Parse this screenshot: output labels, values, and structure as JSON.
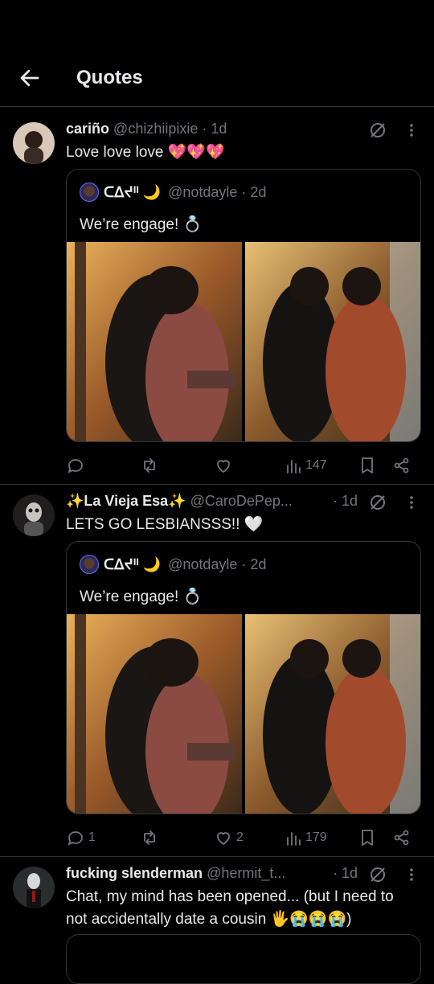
{
  "header": {
    "title": "Quotes"
  },
  "posts": [
    {
      "name": "cariño",
      "handle": "@chizhiipixie · 1d",
      "text": "Love love love 💖💖💖",
      "quote": {
        "name": "ᑕᐃᔪᐦ 🌙",
        "handle": "@notdayle · 2d",
        "text": "We’re engage! 💍"
      },
      "replies": "",
      "reposts": "",
      "likes": "",
      "views": "147"
    },
    {
      "name": "✨La Vieja Esa✨",
      "handle": "@CaroDePep...",
      "time": "· 1d",
      "text": "LETS GO LESBIANSSS!! 🤍",
      "quote": {
        "name": "ᑕᐃᔪᐦ 🌙",
        "handle": "@notdayle · 2d",
        "text": "We’re engage! 💍"
      },
      "replies": "1",
      "reposts": "",
      "likes": "2",
      "views": "179"
    },
    {
      "name": "fucking slenderman",
      "handle": "@hermit_t...",
      "time": "· 1d",
      "text": "Chat, my mind has been opened... (but I need to not accidentally date a cousin 🖐😭😭😭)"
    }
  ],
  "colors": {
    "background": "#000000",
    "text": "#e7e9ea",
    "muted": "#71767b",
    "divider": "#2f3336"
  }
}
